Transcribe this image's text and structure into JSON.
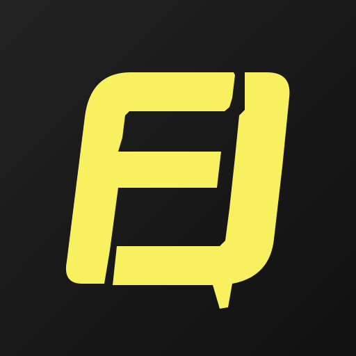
{
  "app_icon": {
    "logo_name": "fe-monogram-logo",
    "colors": {
      "background_top": "#222222",
      "background_bottom": "#111111",
      "logo": "#F8F05F"
    }
  }
}
